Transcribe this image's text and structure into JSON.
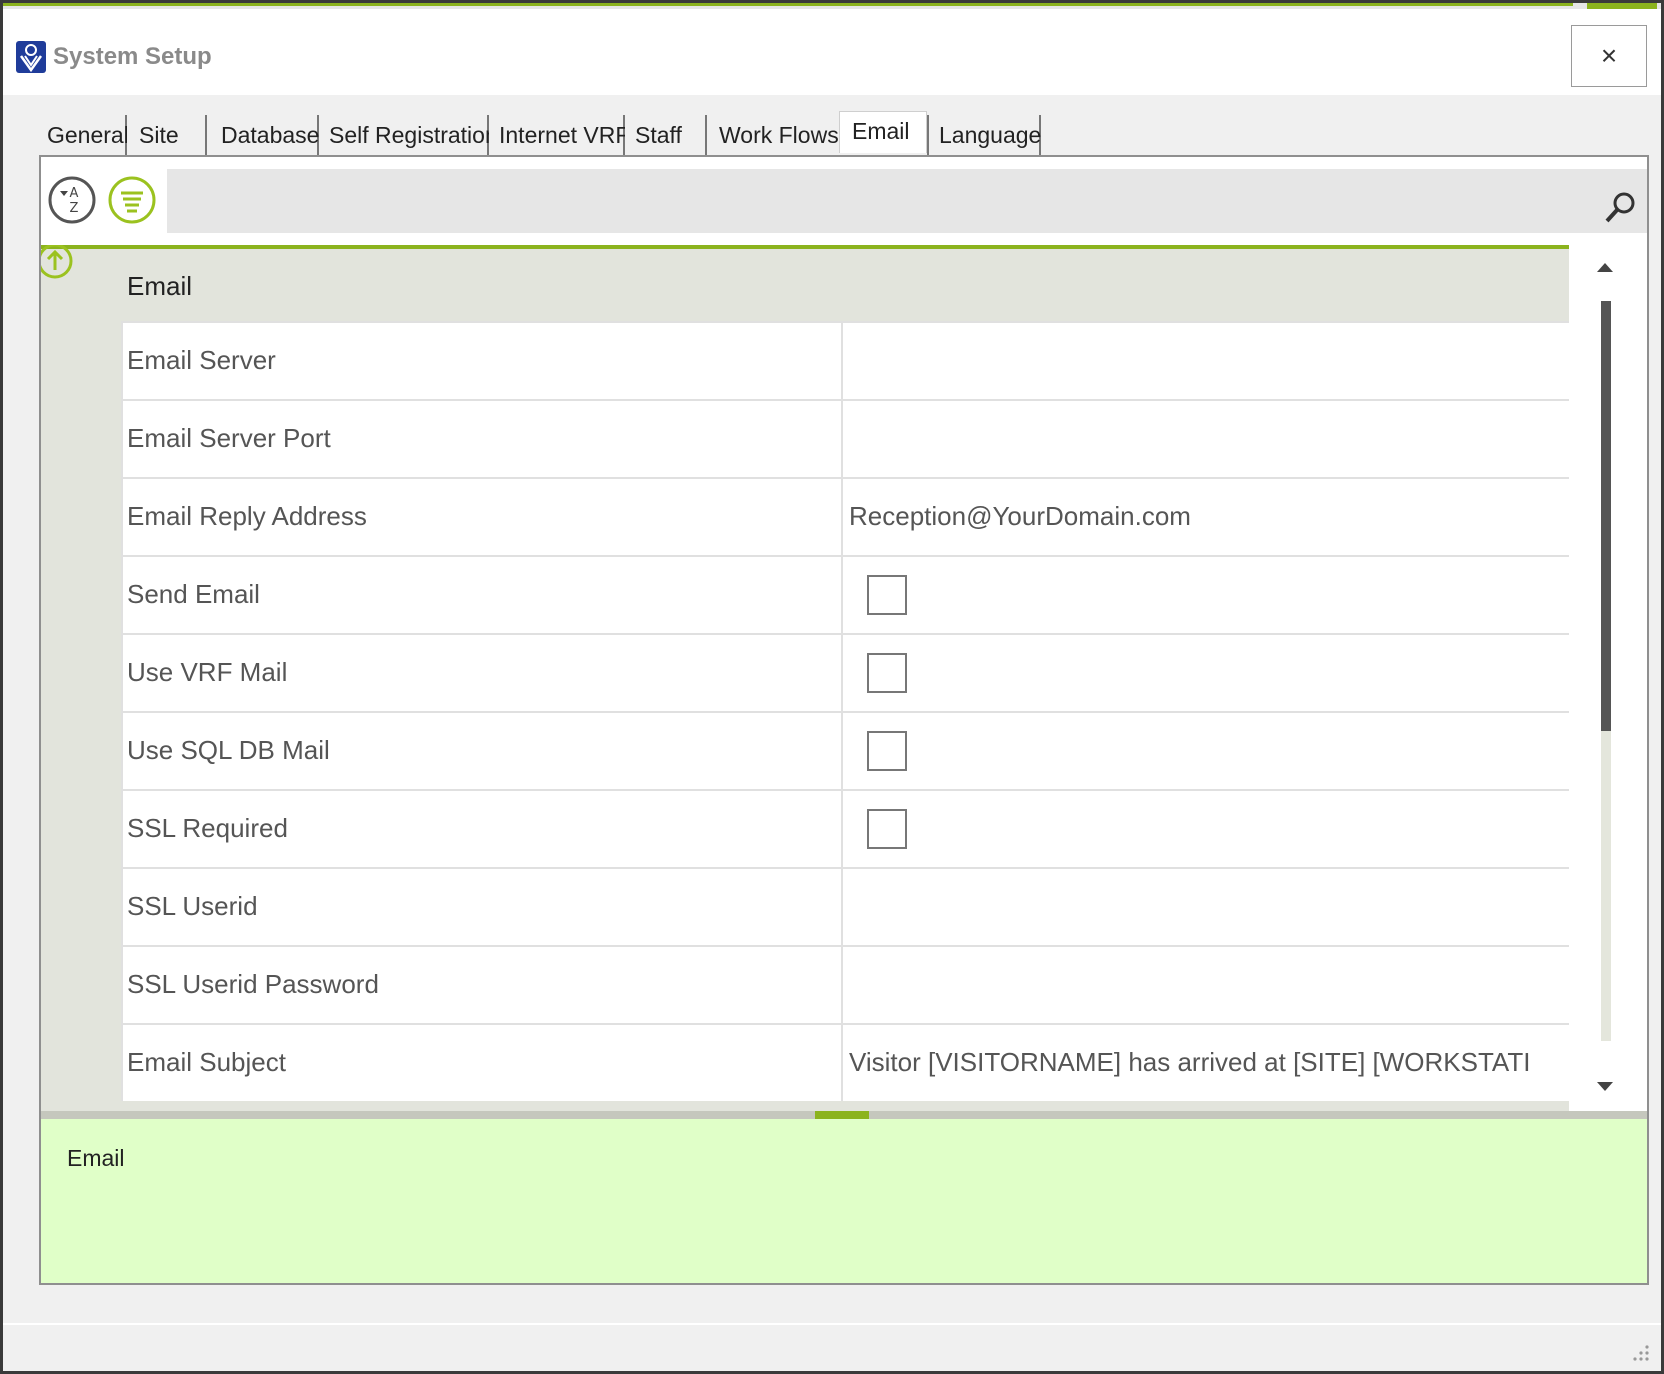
{
  "window": {
    "title": "System Setup",
    "close_label": "×",
    "accent_color": "#8bb31d"
  },
  "tabs": [
    {
      "label": "General"
    },
    {
      "label": "Site"
    },
    {
      "label": "Database"
    },
    {
      "label": "Self Registration"
    },
    {
      "label": "Internet VRF"
    },
    {
      "label": "Staff"
    },
    {
      "label": "Work Flows"
    },
    {
      "label": "Email",
      "active": true
    },
    {
      "label": "Language"
    }
  ],
  "toolbar": {
    "sort_alpha_icon": "sort-alphabetical-icon",
    "categorized_icon": "categorized-list-icon",
    "search_placeholder": "",
    "search_icon": "search-icon"
  },
  "grid": {
    "category": "Email",
    "properties": [
      {
        "name": "Email Server",
        "value": "",
        "type": "text"
      },
      {
        "name": "Email Server Port",
        "value": "",
        "type": "text"
      },
      {
        "name": "Email Reply Address",
        "value": "Reception@YourDomain.com",
        "type": "text"
      },
      {
        "name": "Send Email",
        "value": "",
        "type": "checkbox"
      },
      {
        "name": "Use VRF Mail",
        "value": "",
        "type": "checkbox"
      },
      {
        "name": "Use SQL DB Mail",
        "value": "",
        "type": "checkbox"
      },
      {
        "name": "SSL Required",
        "value": "",
        "type": "checkbox"
      },
      {
        "name": "SSL Userid",
        "value": "",
        "type": "text"
      },
      {
        "name": "SSL Userid Password",
        "value": "",
        "type": "text"
      },
      {
        "name": "Email Subject",
        "value": "Visitor [VISITORNAME] has arrived at [SITE] [WORKSTATI",
        "type": "text"
      }
    ]
  },
  "description": {
    "title": "Email"
  }
}
